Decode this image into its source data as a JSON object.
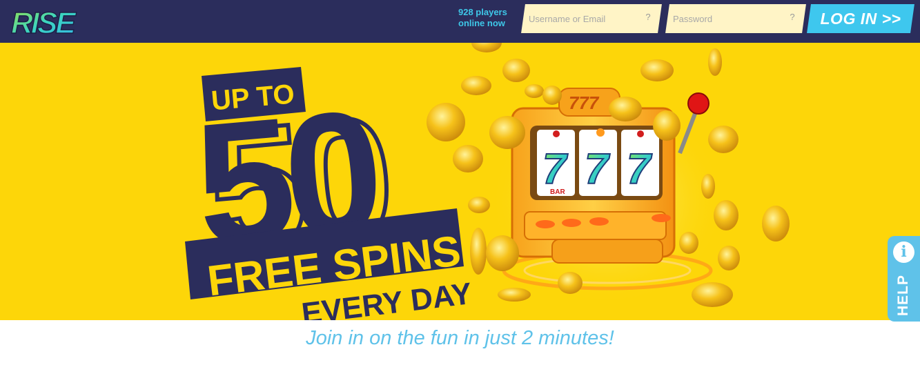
{
  "header": {
    "logo_text": "RISE",
    "players_online": "928 players online now",
    "username_placeholder": "Username or Email",
    "password_placeholder": "Password",
    "help_hint": "?",
    "login_label": "LOG IN >>"
  },
  "banner": {
    "line_up_to": "UP TO",
    "number": "50",
    "line_free_spins": "FREE SPINS",
    "line_every_day": "EVERY DAY",
    "slot_top": "777",
    "reel_symbol": "7",
    "bar_label": "BAR"
  },
  "help": {
    "label": "HELP",
    "icon": "i"
  },
  "tagline": "Join in on the fun in just 2 minutes!",
  "colors": {
    "header_bg": "#2b2d5c",
    "banner_bg": "#fdd609",
    "accent_blue": "#3ec7ee",
    "navy_text": "#2b2d5c",
    "field_bg": "#fff4c6"
  }
}
